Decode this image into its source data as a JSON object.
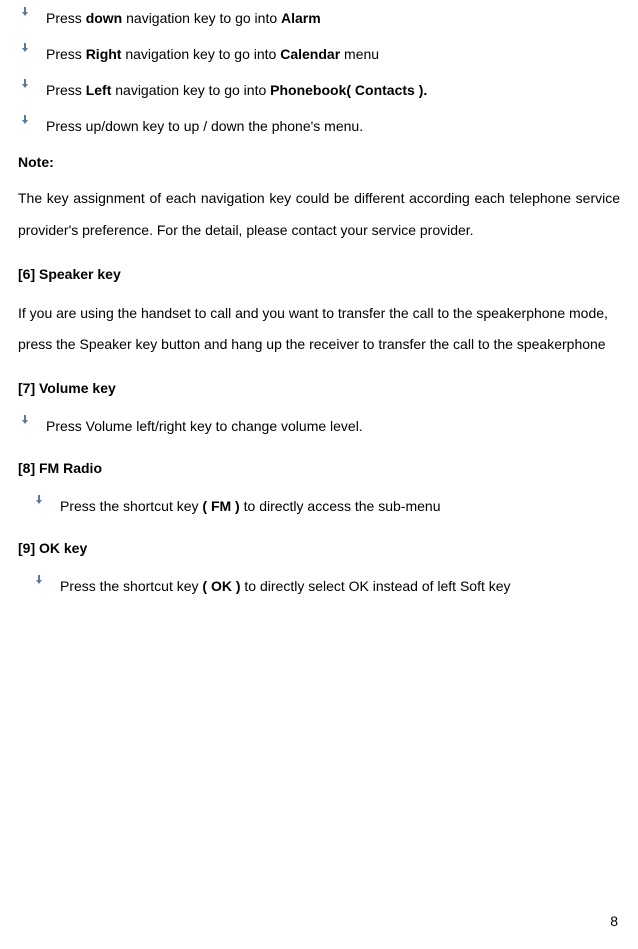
{
  "bullets_top": [
    {
      "pre": "Press ",
      "b1": "down",
      "mid": " navigation key to go into ",
      "b2": "Alarm",
      "post": ""
    },
    {
      "pre": "Press ",
      "b1": "Right",
      "mid": " navigation key to go into ",
      "b2": "Calendar",
      "post": " menu"
    },
    {
      "pre": "Press ",
      "b1": "Left",
      "mid": " navigation key to go into ",
      "b2": "Phonebook( Contacts ).",
      "post": ""
    },
    {
      "pre": "Press up/down key to up / down the phone's menu.",
      "b1": "",
      "mid": "",
      "b2": "",
      "post": ""
    }
  ],
  "note_label": "Note:",
  "note_para": "The key assignment of each navigation key could be different according each telephone service provider's preference. For the detail, please contact your service provider.",
  "section6": {
    "heading": "[6]   Speaker  key",
    "para": "If you are using the handset to call and you want to transfer the call to the speakerphone mode, press the Speaker key button and hang up the receiver to transfer the call to the speakerphone"
  },
  "section7": {
    "heading": "[7]   Volume  key",
    "bullet": "Press Volume left/right key to change volume level."
  },
  "section8": {
    "heading": "[8]   FM  Radio",
    "bullet_pre": "Press the shortcut key ",
    "bullet_bold": "( FM )",
    "bullet_post": " to directly access the sub-menu"
  },
  "section9": {
    "heading": "[9]   OK  key",
    "bullet_pre": "Press the shortcut key ",
    "bullet_bold": "( OK )",
    "bullet_post": " to directly select OK instead of left Soft key"
  },
  "page_number": "8"
}
